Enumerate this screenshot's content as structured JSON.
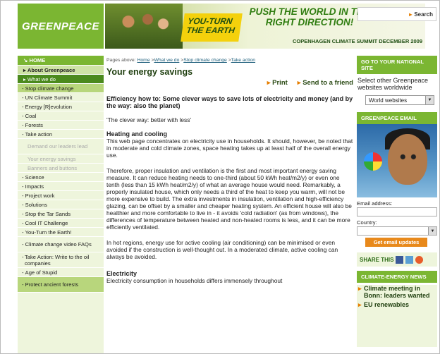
{
  "header": {
    "logo_text": "GREENPEACE",
    "banner_uturn": "YOU-TURN THE EARTH",
    "banner_headline": "PUSH THE WORLD IN THE RIGHT DIRECTION!",
    "banner_event": "COPENHAGEN CLIMATE SUMMIT DECEMBER 2009",
    "search_label": "Search"
  },
  "nav": {
    "items": [
      {
        "label": "HOME"
      },
      {
        "label": "About Greenpeace"
      },
      {
        "label": "What we do"
      },
      {
        "label": "Stop climate change"
      },
      {
        "label": "UN Climate Summit"
      },
      {
        "label": "Energy [R]evolution"
      },
      {
        "label": "Coal"
      },
      {
        "label": "Forests"
      },
      {
        "label": "Take action"
      },
      {
        "label": "Demand our leaders lead"
      },
      {
        "label": "Your energy savings"
      },
      {
        "label": "Banners and buttons"
      },
      {
        "label": "Science"
      },
      {
        "label": "Impacts"
      },
      {
        "label": "Project work"
      },
      {
        "label": "Solutions"
      },
      {
        "label": "Stop the Tar Sands"
      },
      {
        "label": "Cool IT Challenge"
      },
      {
        "label": "You-Turn the Earth!"
      },
      {
        "label": "Climate change video FAQs"
      },
      {
        "label": "Take Action: Write to the oil companies"
      },
      {
        "label": "Age of Stupid"
      },
      {
        "label": "Protect ancient forests"
      }
    ]
  },
  "breadcrumb": {
    "prefix": "Pages above:",
    "links": [
      "Home",
      "What we do",
      "Stop climate change",
      "Take action"
    ]
  },
  "main": {
    "title": "Your energy savings",
    "print_label": "Print",
    "send_label": "Send to a friend",
    "lead": "Efficiency how to: Some clever ways to save lots of electricity and money (and by the way: also the planet)",
    "quote": "'The clever way: better with less'",
    "heading_heating": "Heating and cooling",
    "para1": "This web page concentrates on electricity use in households. It should, however, be noted that in moderate and cold climate zones, space heating takes up at least half of the overall energy use.",
    "para2": "Therefore, proper insulation and ventilation is the first and most important energy saving measure. It can reduce heating needs to one-third (about 50 kWh heat/m2/y) or even one tenth (less than 15 kWh heat/m2/y) of what an average house would need. Remarkably, a properly insulated house, which only needs a third of the heat to keep you warm, will not be more expensive to build. The extra investments in insulation, ventilation and high-efficiency glazing, can be offset by a smaller and cheaper heating system. An efficient house will also be healthier and more comfortable to live in - it avoids 'cold radiation' (as from windows), the differences of temperature between heated and non-heated rooms is less, and it can be more efficiently ventilated.",
    "para3": "In hot regions, energy use for active cooling (air conditioning) can be minimised or even avoided if the construction is well-thought out. In a moderated climate, active cooling can always be avoided.",
    "heading_electricity": "Electricity",
    "para4": "Electricity consumption in households differs immensely throughout"
  },
  "right": {
    "national_title": "GO TO YOUR NATIONAL SITE",
    "national_text": "Select other Greenpeace websites worldwide",
    "world_select": "World websites",
    "email_title": "GREENPEACE EMAIL",
    "email_label": "Email address:",
    "country_label": "Country:",
    "get_updates": "Get email updates",
    "share_label": "SHARE THIS",
    "news_title": "CLIMATE-ENERGY NEWS",
    "news_items": [
      "Climate meeting in Bonn: leaders wanted",
      "EU renewables"
    ]
  }
}
